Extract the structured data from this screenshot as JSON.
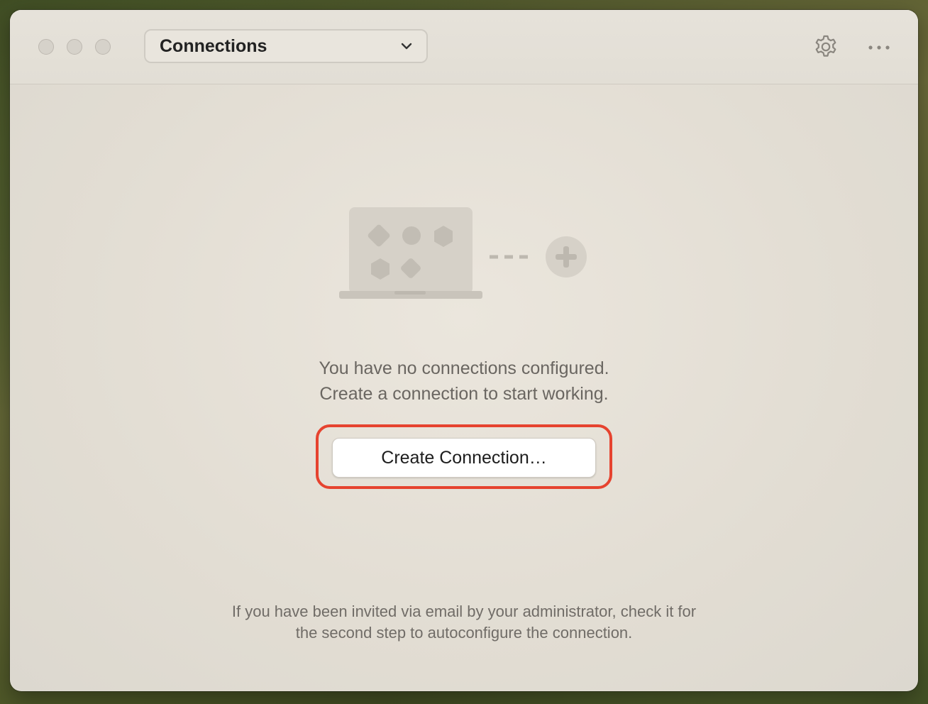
{
  "window": {
    "title_dropdown": {
      "label": "Connections"
    }
  },
  "empty_state": {
    "line1": "You have no connections configured.",
    "line2": "Create a connection to start working.",
    "create_button_label": "Create Connection…"
  },
  "footer": {
    "line1": "If you have been invited via email by your administrator, check it for",
    "line2": "the second step to autoconfigure the connection."
  },
  "icons": {
    "settings": "gear-icon",
    "more": "ellipsis-icon",
    "dropdown": "chevron-down-icon",
    "illustration": "laptop-plus-illustration"
  },
  "colors": {
    "highlight": "#e6432f",
    "window_bg": "#e2ddd3"
  }
}
